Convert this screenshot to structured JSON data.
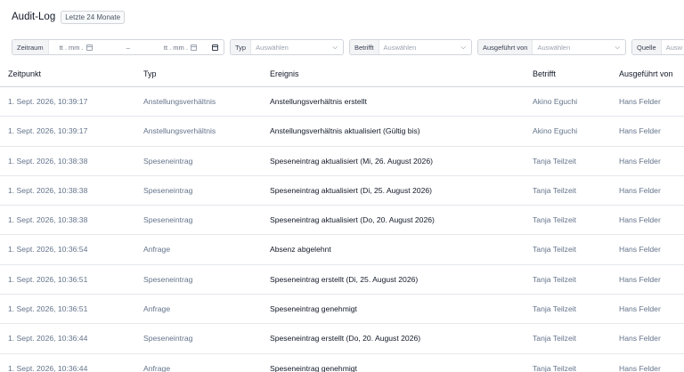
{
  "header": {
    "title": "Audit-Log",
    "badge": "Letzte 24 Monate"
  },
  "filters": {
    "zeitraum_label": "Zeitraum",
    "date_from": "tt . mm .",
    "separator": "–",
    "date_to": "tt . mm .",
    "typ_label": "Typ",
    "typ_placeholder": "Auswählen",
    "betrifft_label": "Betrifft",
    "betrifft_placeholder": "Auswählen",
    "ausgefuehrt_label": "Ausgeführt von",
    "ausgefuehrt_placeholder": "Auswählen",
    "quelle_label": "Quelle",
    "quelle_placeholder": "Ausw"
  },
  "table": {
    "columns": [
      "Zeitpunkt",
      "Typ",
      "Ereignis",
      "Betrifft",
      "Ausgeführt von"
    ],
    "rows": [
      {
        "zeitpunkt": "1. Sept. 2026, 10:39:17",
        "typ": "Anstellungsverhältnis",
        "ereignis": "Anstellungsverhältnis erstellt",
        "betrifft": "Akino Eguchi",
        "ausgefuehrt": "Hans Felder"
      },
      {
        "zeitpunkt": "1. Sept. 2026, 10:39:17",
        "typ": "Anstellungsverhältnis",
        "ereignis": "Anstellungsverhältnis aktualisiert (Gültig bis)",
        "betrifft": "Akino Eguchi",
        "ausgefuehrt": "Hans Felder"
      },
      {
        "zeitpunkt": "1. Sept. 2026, 10:38:38",
        "typ": "Speseneintrag",
        "ereignis": "Speseneintrag aktualisiert (Mi, 26. August 2026)",
        "betrifft": "Tanja Teilzeit",
        "ausgefuehrt": "Hans Felder"
      },
      {
        "zeitpunkt": "1. Sept. 2026, 10:38:38",
        "typ": "Speseneintrag",
        "ereignis": "Speseneintrag aktualisiert (Di, 25. August 2026)",
        "betrifft": "Tanja Teilzeit",
        "ausgefuehrt": "Hans Felder"
      },
      {
        "zeitpunkt": "1. Sept. 2026, 10:38:38",
        "typ": "Speseneintrag",
        "ereignis": "Speseneintrag aktualisiert (Do, 20. August 2026)",
        "betrifft": "Tanja Teilzeit",
        "ausgefuehrt": "Hans Felder"
      },
      {
        "zeitpunkt": "1. Sept. 2026, 10:36:54",
        "typ": "Anfrage",
        "ereignis": "Absenz abgelehnt",
        "betrifft": "Tanja Teilzeit",
        "ausgefuehrt": "Hans Felder"
      },
      {
        "zeitpunkt": "1. Sept. 2026, 10:36:51",
        "typ": "Speseneintrag",
        "ereignis": "Speseneintrag erstellt (Di, 25. August 2026)",
        "betrifft": "Tanja Teilzeit",
        "ausgefuehrt": "Hans Felder"
      },
      {
        "zeitpunkt": "1. Sept. 2026, 10:36:51",
        "typ": "Anfrage",
        "ereignis": "Speseneintrag genehmigt",
        "betrifft": "Tanja Teilzeit",
        "ausgefuehrt": "Hans Felder"
      },
      {
        "zeitpunkt": "1. Sept. 2026, 10:36:44",
        "typ": "Speseneintrag",
        "ereignis": "Speseneintrag erstellt (Do, 20. August 2026)",
        "betrifft": "Tanja Teilzeit",
        "ausgefuehrt": "Hans Felder"
      },
      {
        "zeitpunkt": "1. Sept. 2026, 10:36:44",
        "typ": "Anfrage",
        "ereignis": "Speseneintrag genehmigt",
        "betrifft": "Tanja Teilzeit",
        "ausgefuehrt": "Hans Felder"
      }
    ]
  },
  "icons": {
    "calendar": "calendar-icon",
    "chevron": "chevron-down-icon"
  }
}
